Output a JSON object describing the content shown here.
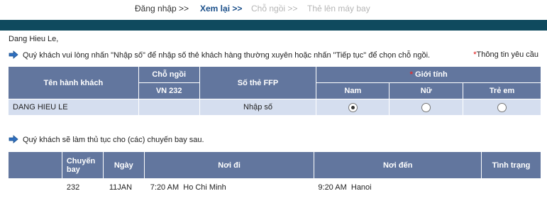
{
  "steps": [
    "Đăng nhập >>",
    "Xem lại >>",
    "Chỗ ngồi >>",
    "Thẻ lên máy bay"
  ],
  "greeting": "Dang Hieu Le,",
  "instruction": "Quý khách vui lòng nhấn \"Nhập số\" để nhập số thẻ khách hàng thường xuyên hoặc nhấn \"Tiếp tục\" để chọn chỗ ngồi.",
  "required_note": {
    "star": "*",
    "text": "Thông tin yêu cầu"
  },
  "passenger_table": {
    "headers": {
      "name": "Tên hành khách",
      "seat": "Chỗ ngồi",
      "flight": "VN 232",
      "ffp": "Số thẻ FFP",
      "gender_star": "*",
      "gender": " Giới tính",
      "male": "Nam",
      "female": "Nữ",
      "child": "Trẻ em"
    },
    "rows": [
      {
        "name": "DANG HIEU LE",
        "seat": "",
        "ffp_link": "Nhập số",
        "gender_selected": "male"
      }
    ]
  },
  "flights_note": "Quý khách sẽ làm thủ tục cho (các) chuyến bay sau.",
  "flight_table": {
    "headers": {
      "flight_line1": "Chuyến",
      "flight_line2": "bay",
      "date": "Ngày",
      "from": "Nơi đi",
      "to": "Nơi đến",
      "status": "Tình trạng"
    },
    "rows": [
      {
        "flight": "232",
        "date": "11JAN",
        "dep_time": "7:20 AM",
        "from": "Ho Chi Minh",
        "arr_time": "9:20 AM",
        "to": "Hanoi",
        "status": ""
      }
    ]
  },
  "colors": {
    "header_bg": "#62769e",
    "row_bg": "#d5deef",
    "top_bar": "#0f4a5e",
    "active_step": "#1a4f8a"
  }
}
